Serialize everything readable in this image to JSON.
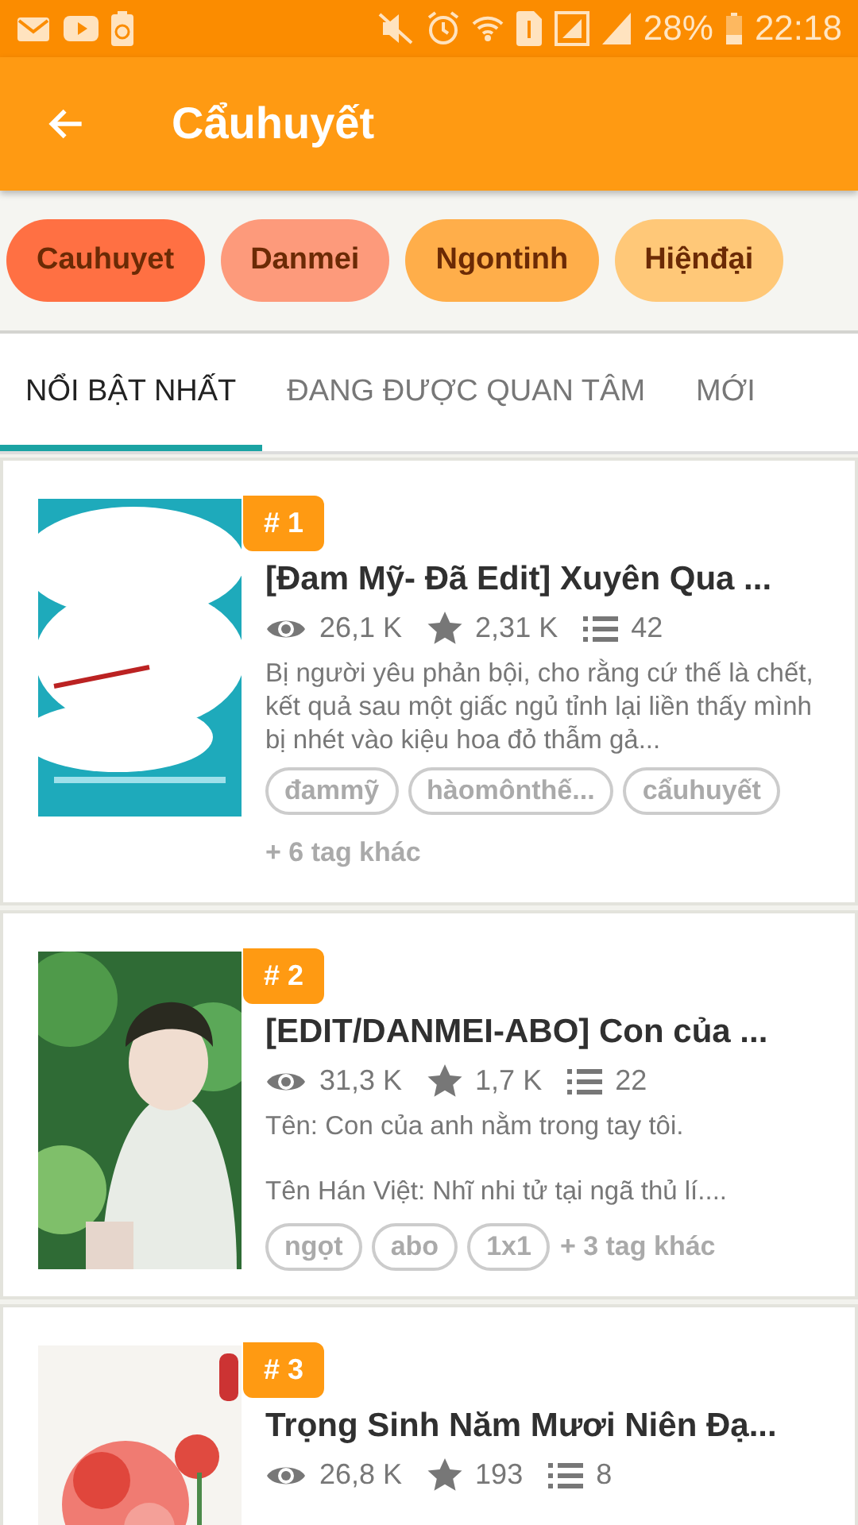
{
  "status_bar": {
    "battery": "28%",
    "time": "22:18"
  },
  "app_bar": {
    "title": "Cẩuhuyết"
  },
  "chips": [
    {
      "label": "Cauhuyet",
      "color": "#ff7043"
    },
    {
      "label": "Danmei",
      "color": "#fd9a7b"
    },
    {
      "label": "Ngontinh",
      "color": "#ffae4a"
    },
    {
      "label": "Hiệnđại",
      "color": "#ffc878"
    }
  ],
  "tabs": [
    {
      "label": "NỔI BẬT NHẤT",
      "selected": true
    },
    {
      "label": "ĐANG ĐƯỢC QUAN TÂM",
      "selected": false
    },
    {
      "label": "MỚI",
      "selected": false
    }
  ],
  "books": [
    {
      "rank": "# 1",
      "cover": {
        "kind": "picture"
      },
      "title": "[Đam Mỹ- Đã Edit] Xuyên Qua ...",
      "views": "26,1 K",
      "votes": "2,31 K",
      "chapters": "42",
      "description": [
        "Bị người yêu phản bội, cho rằng cứ thế là chết, kết quả sau một giấc ngủ tỉnh lại liền thấy mình bị nhét vào kiệu hoa đỏ thẫm gả..."
      ],
      "tags": [
        "đammỹ",
        "hàomônthế...",
        "cẩuhuyết"
      ],
      "more_tags": "+ 6 tag khác"
    },
    {
      "rank": "# 2",
      "cover": {
        "kind": "picture"
      },
      "title": "[EDIT/DANMEI-ABO] Con của ...",
      "views": "31,3 K",
      "votes": "1,7 K",
      "chapters": "22",
      "description": [
        "Tên: Con của anh nằm trong tay tôi.",
        " Tên Hán Việt: Nhĩ nhi tử tại ngã thủ lí...."
      ],
      "tags": [
        "ngọt",
        "abo",
        "1x1"
      ],
      "more_tags": "+ 3 tag khác"
    },
    {
      "rank": "# 3",
      "cover": {
        "kind": "picture"
      },
      "title": "Trọng Sinh Năm Mươi Niên Đạ...",
      "views": "26,8 K",
      "votes": "193",
      "chapters": "8"
    }
  ]
}
